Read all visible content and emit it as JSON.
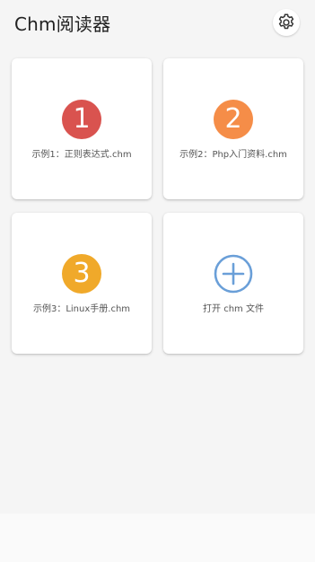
{
  "app": {
    "title": "Chm阅读器",
    "settings_icon": "gear-icon"
  },
  "cards": [
    {
      "badge": "1",
      "label": "示例1：正则表达式.chm",
      "color": "#d9534f"
    },
    {
      "badge": "2",
      "label": "示例2：Php入门资料.chm",
      "color": "#f58d48"
    },
    {
      "badge": "3",
      "label": "示例3：Linux手册.chm",
      "color": "#f0a92a"
    },
    {
      "icon": "plus-circle-icon",
      "label": "打开 chm 文件",
      "color": "#6a9fd8"
    }
  ]
}
